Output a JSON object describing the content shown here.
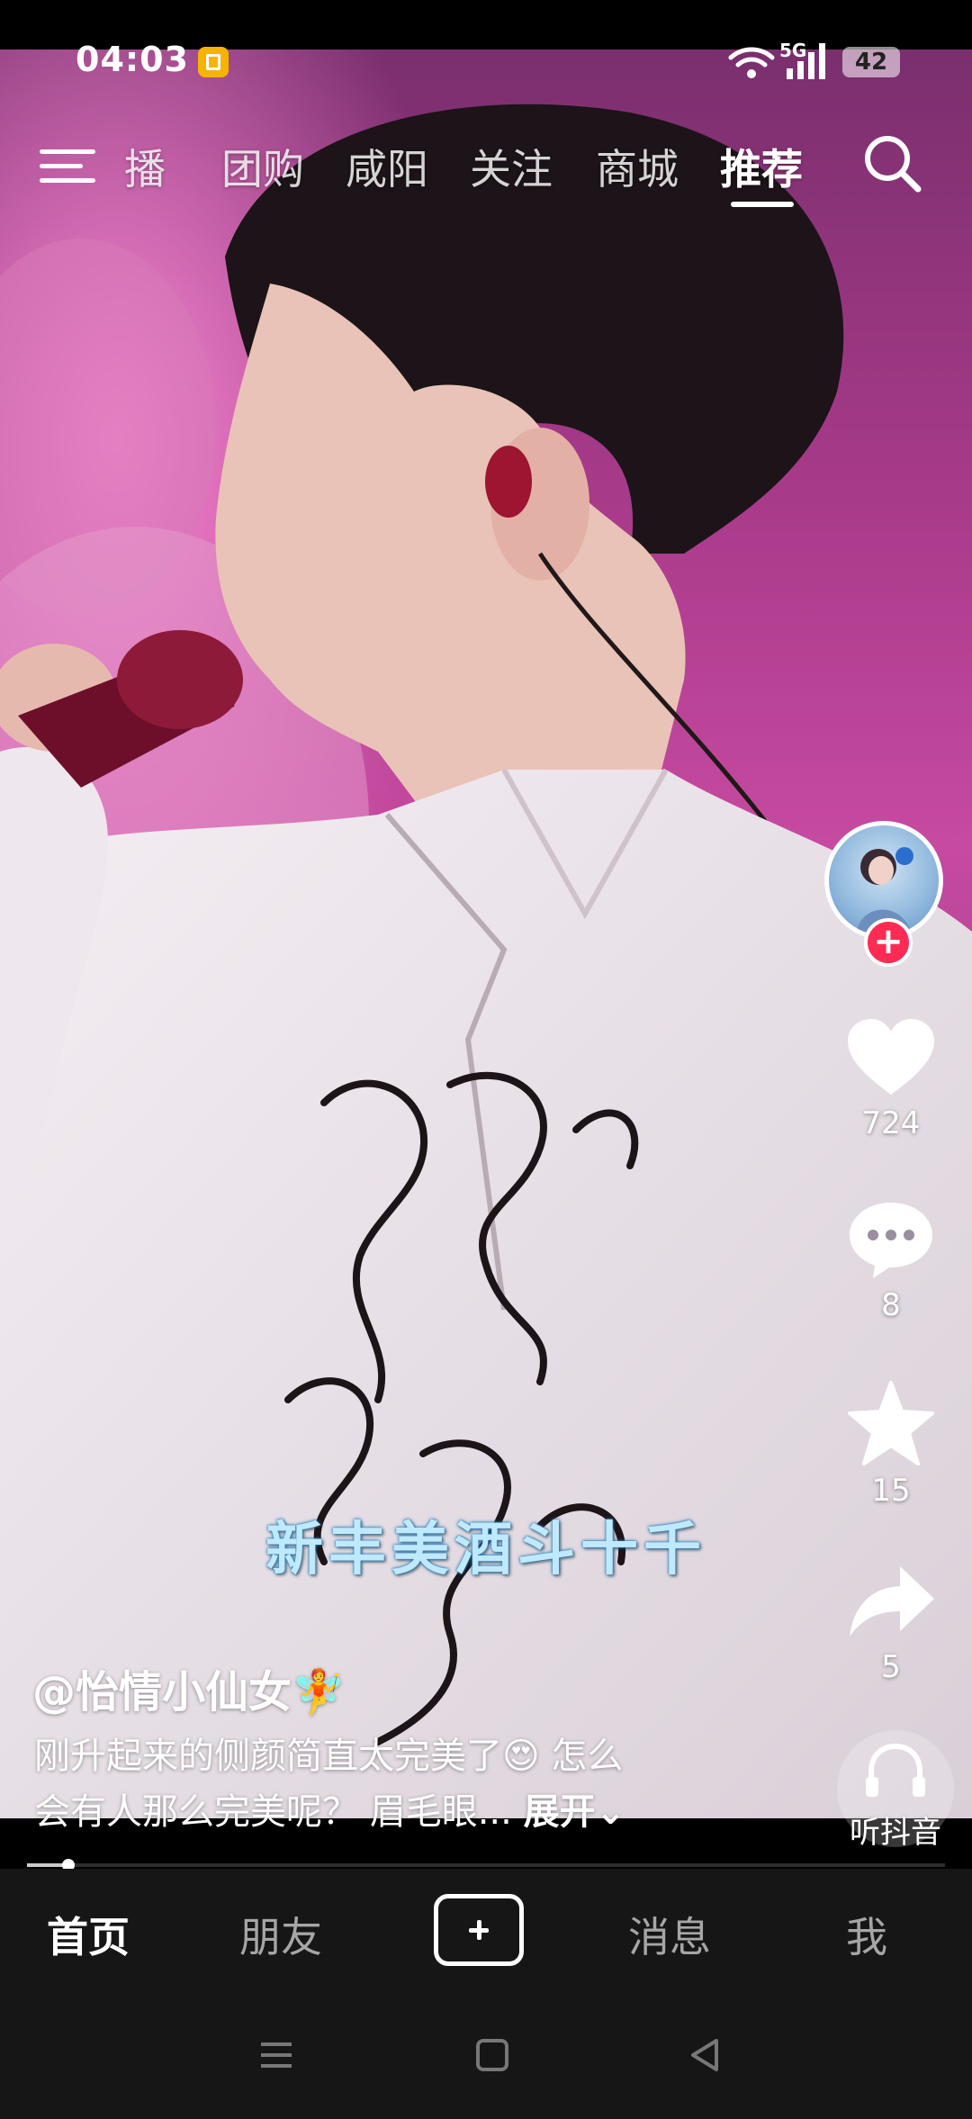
{
  "status_bar": {
    "time": "04:03",
    "network": "5G",
    "battery": "42",
    "icons": [
      "notification-icon",
      "wifi-icon",
      "signal-icon",
      "battery-icon"
    ]
  },
  "top_nav": {
    "tabs": [
      {
        "label": "播"
      },
      {
        "label": "团购"
      },
      {
        "label": "咸阳"
      },
      {
        "label": "关注"
      },
      {
        "label": "商城"
      },
      {
        "label": "推荐"
      }
    ],
    "active_tab": "推荐"
  },
  "video": {
    "caption": "新丰美酒斗十千"
  },
  "actions": {
    "likes": "724",
    "comments": "8",
    "favorites": "15",
    "shares": "5",
    "listen_label": "听抖音"
  },
  "post": {
    "author": "@怡情小仙女🧚",
    "description_line1": "刚升起来的侧颜简直太完美了😍 怎么",
    "description_line2": "会有人那么完美呢？ 眉毛眼... ",
    "expand_label": "展开⌄"
  },
  "playback": {
    "progress": 0.045
  },
  "bottom_nav": {
    "items": [
      {
        "label": "首页"
      },
      {
        "label": "朋友"
      },
      {
        "label": "消息"
      },
      {
        "label": "我"
      }
    ],
    "active": "首页"
  },
  "colors": {
    "like": "#ffffff",
    "follow": "#fe2c55",
    "caption_text": "#bfe9ff",
    "bar_background": "#161616"
  }
}
